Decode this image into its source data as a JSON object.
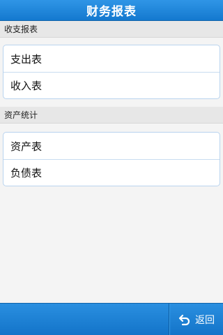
{
  "header": {
    "title": "财务报表"
  },
  "sections": [
    {
      "title": "收支报表",
      "items": [
        {
          "label": "支出表"
        },
        {
          "label": "收入表"
        }
      ]
    },
    {
      "title": "资产统计",
      "items": [
        {
          "label": "资产表"
        },
        {
          "label": "负债表"
        }
      ]
    }
  ],
  "footer": {
    "back_label": "返回",
    "back_icon": "undo-arrow-icon"
  },
  "colors": {
    "accent": "#1a80d6",
    "section_bg": "#e7e7e7",
    "card_border": "#b9d3ee"
  }
}
